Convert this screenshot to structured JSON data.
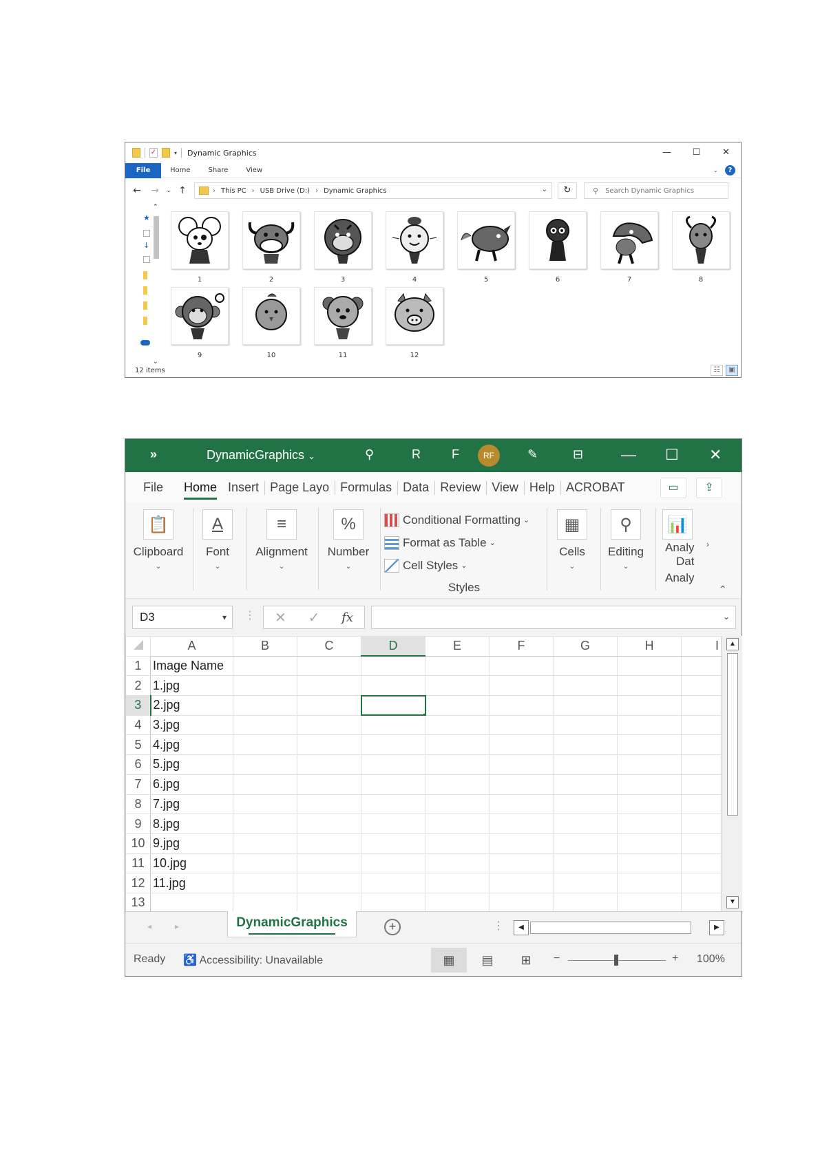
{
  "explorer": {
    "title": "Dynamic Graphics",
    "ribbon_tabs": [
      "File",
      "Home",
      "Share",
      "View"
    ],
    "breadcrumb": [
      "This PC",
      "USB Drive (D:)",
      "Dynamic Graphics"
    ],
    "search_placeholder": "Search Dynamic Graphics",
    "items": [
      {
        "label": "1"
      },
      {
        "label": "2"
      },
      {
        "label": "3"
      },
      {
        "label": "4"
      },
      {
        "label": "5"
      },
      {
        "label": "6"
      },
      {
        "label": "7"
      },
      {
        "label": "8"
      },
      {
        "label": "9"
      },
      {
        "label": "10"
      },
      {
        "label": "11"
      },
      {
        "label": "12"
      }
    ],
    "status": "12 items",
    "help_icon": "?"
  },
  "excel": {
    "title": "DynamicGraphics",
    "title_icons": {
      "more": "»",
      "user_r": "R",
      "user_f": "F",
      "avatar": "RF"
    },
    "tabs": [
      "File",
      "Home",
      "Insert",
      "Page Layo",
      "Formulas",
      "Data",
      "Review",
      "View",
      "Help",
      "ACROBAT"
    ],
    "ribbon": {
      "clipboard": "Clipboard",
      "font": "Font",
      "alignment": "Alignment",
      "number": "Number",
      "number_icon": "%",
      "conditional_formatting": "Conditional Formatting",
      "format_as_table": "Format as Table",
      "cell_styles": "Cell Styles",
      "styles": "Styles",
      "cells": "Cells",
      "editing": "Editing",
      "analyze_1": "Analy",
      "analyze_2": "Dat",
      "analyze_group": "Analy"
    },
    "name_box": "D3",
    "formula_value": "",
    "columns": [
      "A",
      "B",
      "C",
      "D",
      "E",
      "F",
      "G",
      "H",
      "I"
    ],
    "selected_column": "D",
    "selected_row": 3,
    "rows": [
      {
        "num": "1",
        "a": "Image Name"
      },
      {
        "num": "2",
        "a": "1.jpg"
      },
      {
        "num": "3",
        "a": "2.jpg"
      },
      {
        "num": "4",
        "a": "3.jpg"
      },
      {
        "num": "5",
        "a": "4.jpg"
      },
      {
        "num": "6",
        "a": "5.jpg"
      },
      {
        "num": "7",
        "a": "6.jpg"
      },
      {
        "num": "8",
        "a": "7.jpg"
      },
      {
        "num": "9",
        "a": "8.jpg"
      },
      {
        "num": "10",
        "a": "9.jpg"
      },
      {
        "num": "11",
        "a": "10.jpg"
      },
      {
        "num": "12",
        "a": "11.jpg"
      },
      {
        "num": "13",
        "a": ""
      }
    ],
    "sheet_tab": "DynamicGraphics",
    "status_ready": "Ready",
    "accessibility": "Accessibility: Unavailable",
    "zoom": "100%",
    "zoom_minus": "−",
    "zoom_plus": "+",
    "accent": "#217346"
  }
}
